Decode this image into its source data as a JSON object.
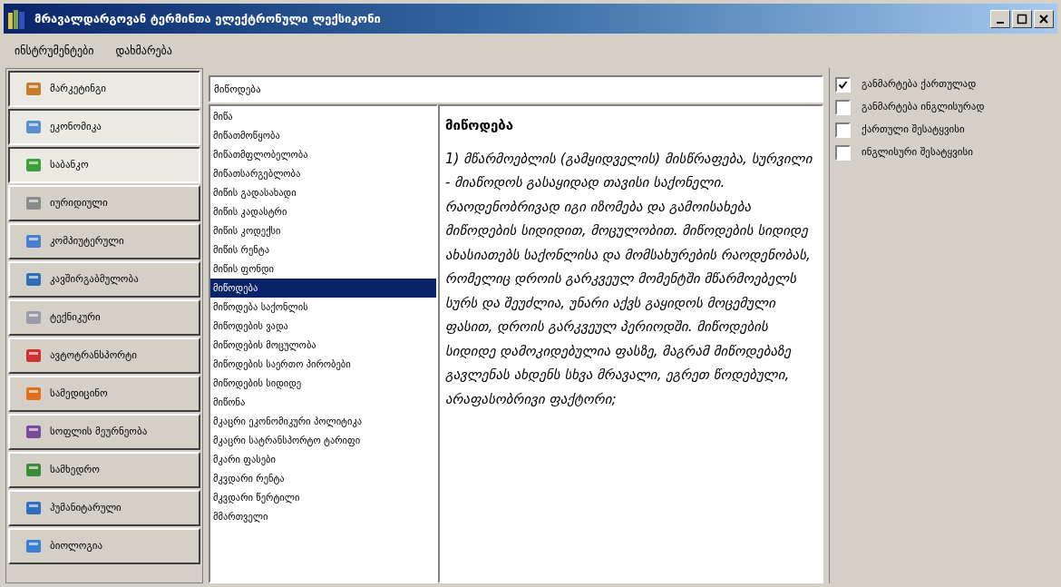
{
  "window": {
    "title": "მრავალდარგოვან ტერმინთა ელექტრონული ლექსიკონი"
  },
  "menu": [
    "ინსტრუმენტები",
    "დახმარება"
  ],
  "sidebar": {
    "items": [
      {
        "label": "მარკეტინგი",
        "pressed": true
      },
      {
        "label": "ეკონომიკა",
        "pressed": true
      },
      {
        "label": "საბანკო",
        "pressed": true
      },
      {
        "label": "იურიდიული",
        "pressed": false
      },
      {
        "label": "კომპიუტერული",
        "pressed": false
      },
      {
        "label": "კავშირგაბმულობა",
        "pressed": false
      },
      {
        "label": "ტექნიკური",
        "pressed": false
      },
      {
        "label": "ავტოტრანსპორტი",
        "pressed": false
      },
      {
        "label": "სამედიცინო",
        "pressed": false
      },
      {
        "label": "სოფლის მეურნეობა",
        "pressed": false
      },
      {
        "label": "სამხედრო",
        "pressed": false
      },
      {
        "label": "ჰუმანიტარული",
        "pressed": false
      },
      {
        "label": "ბიოლოგია",
        "pressed": false
      }
    ]
  },
  "search": {
    "value": "მიწოდება"
  },
  "terms": [
    {
      "label": "მიწა",
      "selected": false
    },
    {
      "label": "მიწათმოწყობა",
      "selected": false
    },
    {
      "label": "მიწათმფლობელობა",
      "selected": false
    },
    {
      "label": "მიწათსარგებლობა",
      "selected": false
    },
    {
      "label": "მიწის გადასახადი",
      "selected": false
    },
    {
      "label": "მიწის კადასტრი",
      "selected": false
    },
    {
      "label": "მიწის კოდექსი",
      "selected": false
    },
    {
      "label": "მიწის რენტა",
      "selected": false
    },
    {
      "label": "მიწის ფონდი",
      "selected": false
    },
    {
      "label": "მიწოდება",
      "selected": true
    },
    {
      "label": "მიწოდება საქონლის",
      "selected": false
    },
    {
      "label": "მიწოდების ვადა",
      "selected": false
    },
    {
      "label": "მიწოდების მოცულობა",
      "selected": false
    },
    {
      "label": "მიწოდების საერთო პირობები",
      "selected": false
    },
    {
      "label": "მიწოდების სიდიდე",
      "selected": false
    },
    {
      "label": "მიწონა",
      "selected": false
    },
    {
      "label": "მკაცრი ეკონომიკური პოლიტიკა",
      "selected": false
    },
    {
      "label": "მკაცრი სატრანსპორტო ტარიფი",
      "selected": false
    },
    {
      "label": "მკარი ფასები",
      "selected": false
    },
    {
      "label": "მკვდარი რენტა",
      "selected": false
    },
    {
      "label": "მკვდარი წერტილი",
      "selected": false
    },
    {
      "label": "მმართველი",
      "selected": false
    }
  ],
  "definition": {
    "term": "მიწოდება",
    "text": "1) მწარმოებლის (გამყიდველის) მისწრაფება, სურვილი - მიაწოდოს გასაყიდად თავისი საქონელი. რაოდენობრივად იგი იზომება და გამოისახება მიწოდების სიდიდით, მოცულობით. მიწოდების სიდიდე ახასიათებს საქონლისა და მომსახურების რაოდენობას, რომელიც დროის გარკვეულ მომენტში მწარმოებელს სურს და შეუძლია, უნარი აქვს გაყიდოს მოცემული ფასით, დროის გარკვეულ პერიოდში. მიწოდების სიდიდე დამოკიდებულია ფასზე, მაგრამ მიწოდებაზე გავლენას ახდენს სხვა მრავალი, ეგრეთ წოდებული, არაფასობრივი ფაქტორი;"
  },
  "options": [
    {
      "label": "განმარტება ქართულად",
      "checked": true
    },
    {
      "label": "განმარტება ინგლისურად",
      "checked": false
    },
    {
      "label": "ქართული შესატყვისი",
      "checked": false
    },
    {
      "label": "ინგლისური შესატყვისი",
      "checked": false
    }
  ]
}
